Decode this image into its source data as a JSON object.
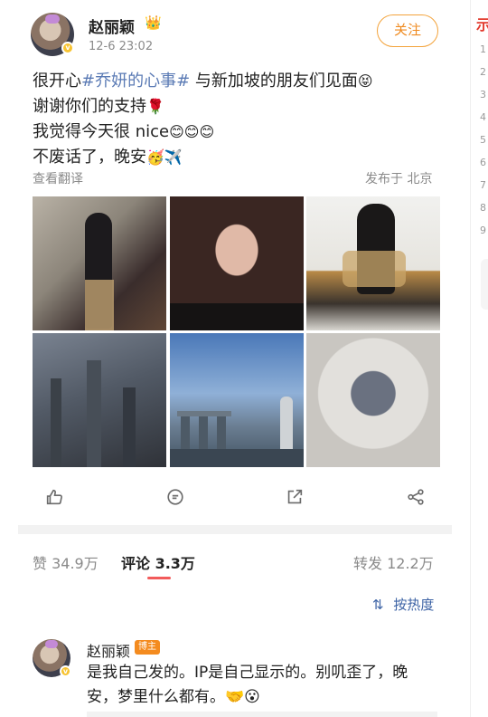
{
  "post": {
    "username": "赵丽颖",
    "time": "12-6 23:02",
    "follow_label": "关注",
    "content": {
      "line1_pre": "很开心",
      "line1_tag": "#乔妍的心事#",
      "line1_post": " 与新加坡的朋友们见面",
      "line1_emoji": "😝",
      "line2": "谢谢你们的支持",
      "line2_emoji": "🌹",
      "line3": "我觉得今天很 nice",
      "line3_emoji": "😊😊😊",
      "line4": "不废话了，晚安",
      "line4_emoji": "🥳✈️"
    },
    "translate_label": "查看翻译",
    "location_label": "发布于 北京"
  },
  "tabs": {
    "likes": "赞 34.9万",
    "comments": "评论 3.3万",
    "reposts": "转发 12.2万"
  },
  "sort_label": "按热度",
  "comment": {
    "username": "赵丽颖",
    "badge": "博主",
    "text": "是我自己发的。IP是自己显示的。别叽歪了，晚安，梦里什么都有。",
    "emoji": "🤝😮"
  },
  "side": {
    "title": "示",
    "numbers": [
      "1",
      "2",
      "3",
      "4",
      "5",
      "6",
      "7",
      "8",
      "9"
    ]
  },
  "colors": {
    "accent_orange": "#ef8a1f",
    "hashtag_blue": "#5b7bb5",
    "tab_underline": "#f25b5b"
  },
  "icons": [
    "like-icon",
    "comment-icon",
    "share-icon",
    "forward-icon",
    "sort-icon",
    "crown-icon"
  ]
}
